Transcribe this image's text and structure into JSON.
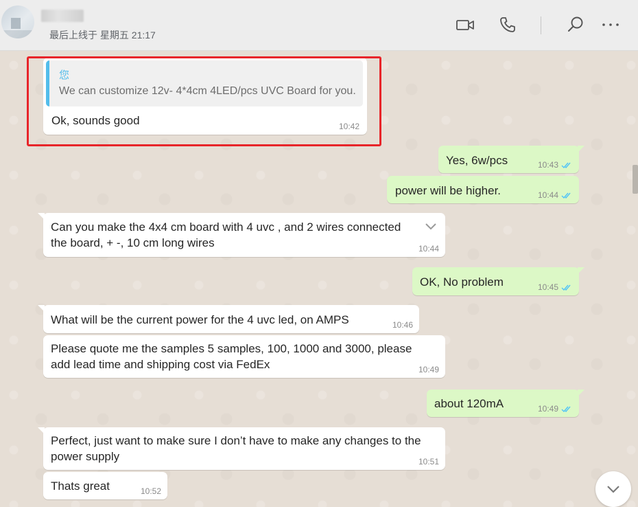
{
  "header": {
    "last_seen": "最后上线于 星期五 21:17",
    "icons": [
      "video-call-icon",
      "voice-call-icon",
      "search-icon",
      "more-options-icon"
    ]
  },
  "messages": [
    {
      "direction": "in",
      "quote_author": "您",
      "quote_text": "We can customize 12v- 4*4cm 4LED/pcs UVC Board for you.",
      "text": "Ok, sounds good",
      "time": "10:42"
    },
    {
      "direction": "out",
      "text": "Yes, 6w/pcs",
      "time": "10:43",
      "status": "read"
    },
    {
      "direction": "out",
      "text": "power will be higher.",
      "time": "10:44",
      "status": "read"
    },
    {
      "direction": "in",
      "text": "Can you make the 4x4 cm board with 4 uvc , and 2 wires connected\nthe board, + -, 10 cm long wires",
      "time": "10:44"
    },
    {
      "direction": "out",
      "text": "OK, No problem",
      "time": "10:45",
      "status": "read"
    },
    {
      "direction": "in",
      "text": "What will be the current power for the 4 uvc led, on AMPS",
      "time": "10:46"
    },
    {
      "direction": "in",
      "text": "Please quote me the samples 5 samples, 100, 1000 and 3000, please\nadd lead time and shipping cost via FedEx",
      "time": "10:49"
    },
    {
      "direction": "out",
      "text": "about 120mA",
      "time": "10:49",
      "status": "read"
    },
    {
      "direction": "in",
      "text": "Perfect, just want to make sure I don’t have to make any changes to the\npower supply",
      "time": "10:51"
    },
    {
      "direction": "in",
      "text": "Thats great",
      "time": "10:52"
    }
  ],
  "colors": {
    "incoming_bubble": "#ffffff",
    "outgoing_bubble": "#dcf8c6",
    "read_ticks": "#4fc3f7",
    "quote_accent": "#53bdeb",
    "highlight_box": "#e8252a",
    "chat_background": "#e6ded5"
  }
}
